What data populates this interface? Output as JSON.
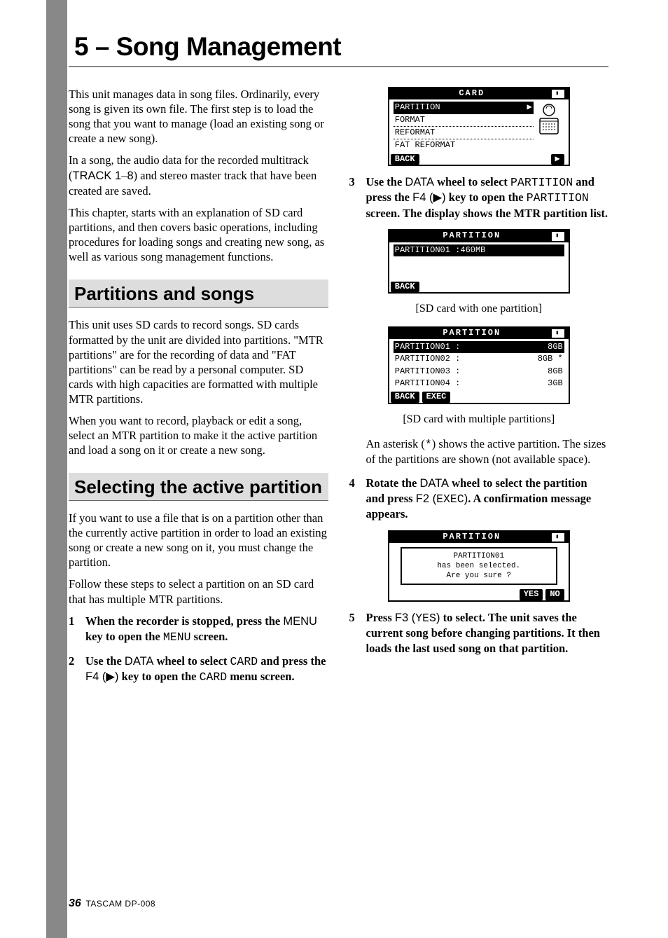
{
  "chapter": {
    "title": "5 – Song Management"
  },
  "intro": {
    "p1": "This unit manages data in song files. Ordinarily, every song is given its own file. The first step is to load the song that you want to manage (load an existing song or create a new song).",
    "p2_a": "In a song, the audio data for the recorded multitrack (",
    "p2_track": "TRACK 1",
    "p2_dash": "–",
    "p2_track2": "8",
    "p2_b": ") and stereo master track that have been created are saved.",
    "p3": "This chapter, starts with an explanation of SD card partitions, and then covers basic operations, including procedures for loading songs and creating new song, as well as various song management functions."
  },
  "sec1": {
    "title": "Partitions and songs",
    "p1": "This unit uses SD cards to record songs. SD cards formatted by the unit are divided into partitions. \"MTR partitions\" are for the recording of data and \"FAT partitions\" can be read by a personal computer. SD cards with high capacities are formatted with multiple MTR partitions.",
    "p2": "When you want to record, playback or edit a song, select an MTR partition to make it the active partition and load a song on it or create a new song."
  },
  "sec2": {
    "title": "Selecting the active partition",
    "p1": "If you want to use a file that is on a partition other than the currently active partition in order to load an existing song or create a new song on it, you must change the partition.",
    "p2": "Follow these steps to select a partition on an SD card that has multiple MTR partitions."
  },
  "steps": {
    "s1": {
      "a": "When the recorder is stopped, press the ",
      "menu_key": "MENU",
      "b": " key to open the ",
      "menu_mono": "MENU",
      "c": " screen."
    },
    "s2": {
      "a": "Use the ",
      "data": "DATA",
      "b": " wheel to select  ",
      "card_mono": "CARD",
      "c": " and press the ",
      "f4": "F4 (▶)",
      "d": " key to open the ",
      "card_mono2": "CARD",
      "e": " menu screen."
    },
    "s3": {
      "a": "Use the ",
      "data": "DATA",
      "b": " wheel to select ",
      "part_mono": "PARTITION",
      "c": " and press the ",
      "f4": "F4 (▶)",
      "d": " key to open the ",
      "part_mono2": "PARTITION",
      "e": " screen.  The display shows the MTR partition list."
    },
    "s3_post": {
      "a": "An asterisk (",
      "ast": "*",
      "b": ") shows the active partition. The sizes of the partitions are shown (not available space)."
    },
    "s4": {
      "a": "Rotate the ",
      "data": "DATA",
      "b": " wheel to select the partition and press ",
      "f2": "F2 (",
      "exec": "EXEC",
      "f2b": ")",
      "c": ". A confirmation message appears."
    },
    "s5": {
      "a": "Press ",
      "f3": "F3 (",
      "yes": "YES",
      "f3b": ")",
      "b": " to select. The unit saves the current song before changing partitions. It then loads the last used song on that partition."
    }
  },
  "screens": {
    "card": {
      "title": "CARD",
      "items": [
        "PARTITION",
        "FORMAT",
        "REFORMAT",
        "FAT REFORMAT"
      ],
      "back": "BACK"
    },
    "part1": {
      "title": "PARTITION",
      "row1_l": "PARTITION01 :460MB",
      "row1_r": "*",
      "back": "BACK",
      "caption": "[SD card with one partition]"
    },
    "partN": {
      "title": "PARTITION",
      "rows": [
        {
          "l": "PARTITION01 :",
          "r": "8GB",
          "sel": true
        },
        {
          "l": "PARTITION02 :",
          "r": "8GB *",
          "sel": false
        },
        {
          "l": "PARTITION03 :",
          "r": "8GB",
          "sel": false
        },
        {
          "l": "PARTITION04 :",
          "r": "3GB",
          "sel": false
        }
      ],
      "back": "BACK",
      "exec": "EXEC",
      "caption": "[SD card with multiple partitions]"
    },
    "confirm": {
      "title": "PARTITION",
      "line1": "PARTITION01",
      "line2": "has been selected.",
      "line3": "Are you sure ?",
      "yes": "YES",
      "no": "NO"
    }
  },
  "footer": {
    "page": "36",
    "model": "TASCAM DP-008"
  }
}
